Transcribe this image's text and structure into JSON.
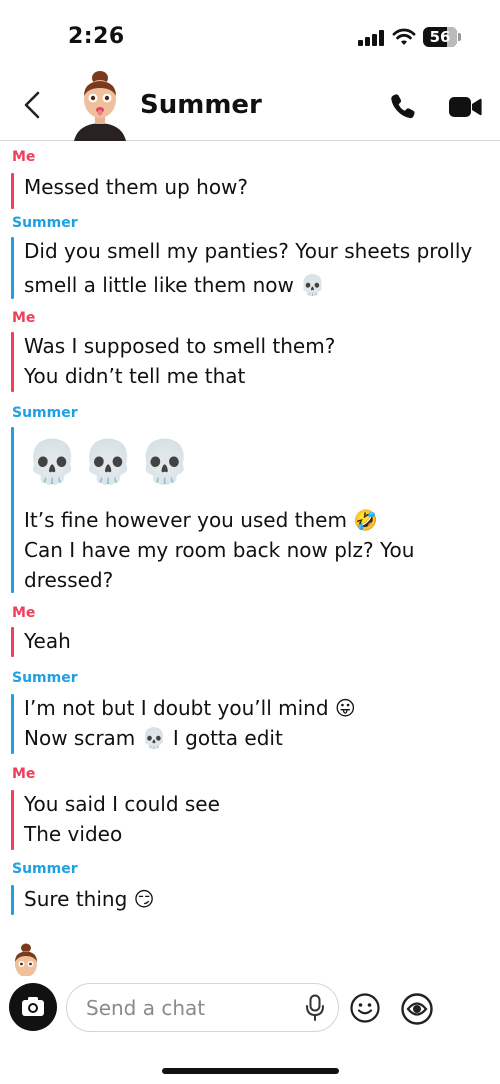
{
  "status_bar": {
    "time": "2:26",
    "battery_level": "56"
  },
  "header": {
    "contact_name": "Summer",
    "back_icon": "chevron-left-icon",
    "call_icon": "phone-icon",
    "video_icon": "video-camera-icon"
  },
  "colors": {
    "me": "#ee3f5b",
    "them": "#1ea1e4"
  },
  "messages": [
    {
      "sender": "Me",
      "lines": [
        "Messed them up how?"
      ]
    },
    {
      "sender": "Summer",
      "lines": [
        "Did you smell my panties? Your sheets prolly",
        "smell a little like them now 💀"
      ]
    },
    {
      "sender": "Me",
      "lines": [
        "Was I supposed to smell them?",
        "You didn’t tell me that"
      ]
    },
    {
      "sender": "Summer",
      "big_emoji": "💀💀💀",
      "lines": [
        "It’s fine however you used them 🤣",
        "Can I have my room back now plz? You",
        "dressed?"
      ]
    },
    {
      "sender": "Me",
      "lines": [
        "Yeah"
      ]
    },
    {
      "sender": "Summer",
      "lines": [
        "I’m not but I doubt you’ll mind 😛",
        "Now scram 💀 I gotta edit"
      ]
    },
    {
      "sender": "Me",
      "lines": [
        "You said I could see",
        "The video"
      ]
    },
    {
      "sender": "Summer",
      "lines": [
        "Sure thing 😏"
      ]
    }
  ],
  "composer": {
    "placeholder": "Send a chat",
    "camera_icon": "camera-icon",
    "mic_icon": "microphone-icon",
    "emoji_icon": "smiley-icon",
    "sticker_icon": "sticker-icon"
  }
}
